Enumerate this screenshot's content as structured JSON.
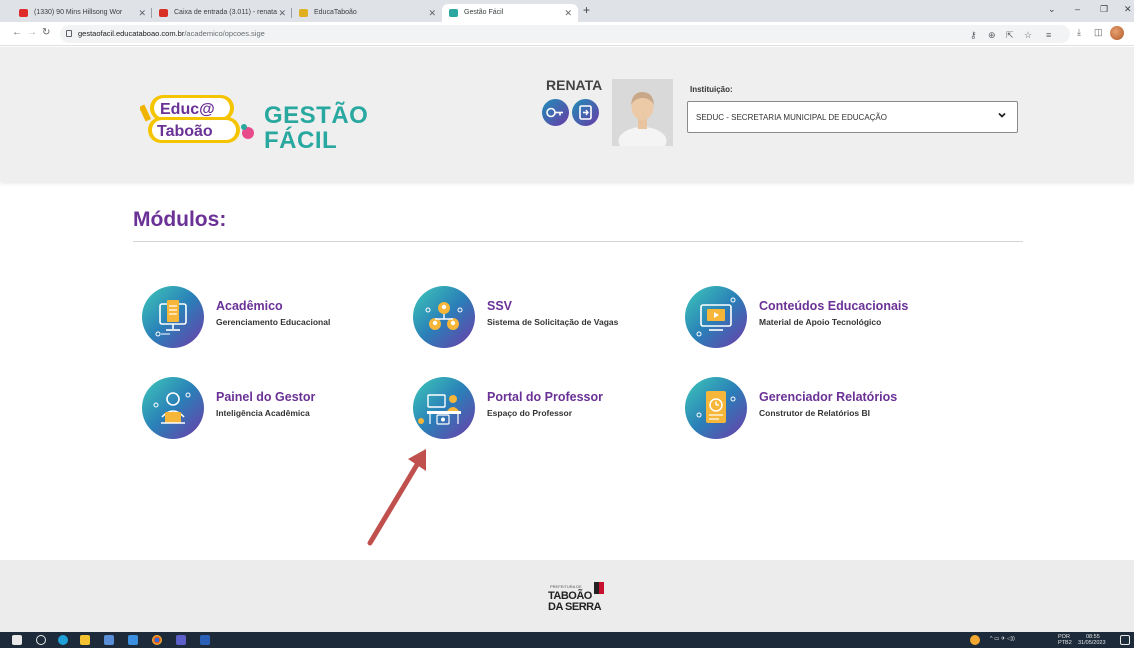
{
  "browser": {
    "tabs": [
      {
        "title": "(1330) 90 Mins Hillsong Wor",
        "fav_color": "#e02b2b"
      },
      {
        "title": "Caixa de entrada (3.011) - renata",
        "fav_color": "#d93025"
      },
      {
        "title": "EducaTaboão",
        "fav_color": "#e0b020"
      },
      {
        "title": "Gestão Fácil",
        "fav_color": "#2aa8a0"
      }
    ],
    "new_tab": "+",
    "url_host": "gestaofacil.educataboao.com.br",
    "url_path": "/academico/opcoes.sige"
  },
  "header": {
    "logo_educ_line1": "Educ@",
    "logo_educ_line2": "Taboão",
    "logo_gestao": "GESTÃO",
    "logo_facil": "FÁCIL",
    "username": "RENATA",
    "institution_label": "Instituição:",
    "institution_value": "SEDUC - SECRETARIA MUNICIPAL DE EDUCAÇÃO"
  },
  "modules_title": "Módulos:",
  "modules": [
    {
      "title": "Acadêmico",
      "subtitle": "Gerenciamento Educacional",
      "icon": "monitor-checklist-icon"
    },
    {
      "title": "SSV",
      "subtitle": "Sistema de Solicitação de Vagas",
      "icon": "people-network-icon"
    },
    {
      "title": "Conteúdos Educacionais",
      "subtitle": "Material de Apoio Tecnológico",
      "icon": "video-screen-icon"
    },
    {
      "title": "Painel do Gestor",
      "subtitle": "Inteligência Acadêmica",
      "icon": "manager-person-icon"
    },
    {
      "title": "Portal do Professor",
      "subtitle": "Espaço do Professor",
      "icon": "teacher-desk-icon"
    },
    {
      "title": "Gerenciador Relatórios",
      "subtitle": "Construtor de Relatórios BI",
      "icon": "report-clock-icon"
    }
  ],
  "footer": {
    "small": "PREFEITURA DE",
    "line1": "TABOÃO",
    "line2": "DA SERRA"
  },
  "taskbar": {
    "lang": "POR",
    "lang2": "PTB2",
    "time": "08:55",
    "date": "31/05/2023"
  },
  "colors": {
    "accent_purple": "#6a3196",
    "accent_teal": "#29a8a0",
    "annotation_arrow": "#c0504d"
  }
}
